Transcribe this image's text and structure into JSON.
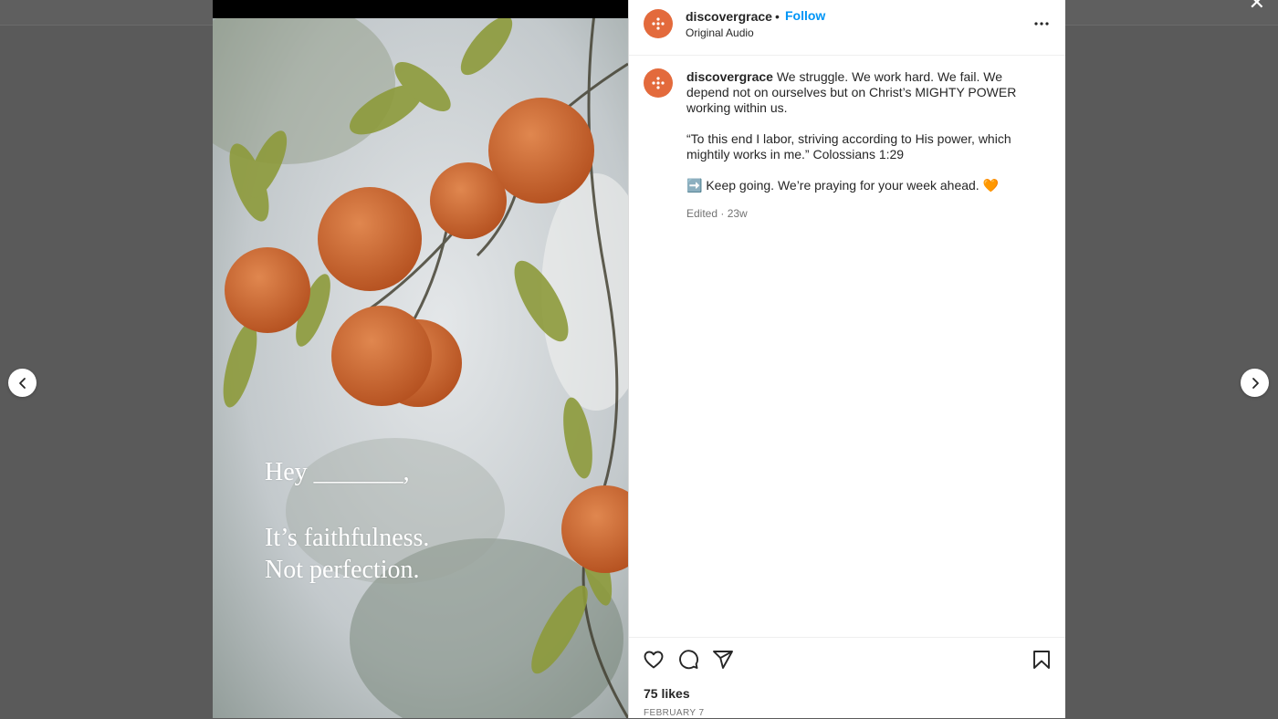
{
  "post": {
    "username": "discovergrace",
    "separator": "•",
    "follow_label": "Follow",
    "audio": "Original Audio",
    "media_text": {
      "line1": "Hey _______,",
      "line2": "It’s faithfulness.",
      "line3": "Not perfection."
    },
    "caption": {
      "username": "discovergrace",
      "paragraph1": "We struggle. We work hard. We fail. We depend not on ourselves but on Christ’s MIGHTY POWER working within us.",
      "paragraph2": "“To this end I labor, striving according to His power, which mightily works in me.” Colossians 1:29",
      "paragraph3": "➡️ Keep going. We’re praying for your week ahead. 🧡",
      "meta": "Edited · 23w"
    },
    "likes": "75 likes",
    "date": "FEBRUARY 7"
  },
  "icons": {
    "close": "close-icon",
    "prev": "chevron-left-icon",
    "next": "chevron-right-icon",
    "more": "more-options-icon",
    "like": "heart-icon",
    "comment": "comment-icon",
    "share": "share-icon",
    "save": "bookmark-icon"
  },
  "colors": {
    "accent": "#0095f6",
    "avatar": "#e36a3c",
    "backdrop": "#5a5a5a"
  }
}
